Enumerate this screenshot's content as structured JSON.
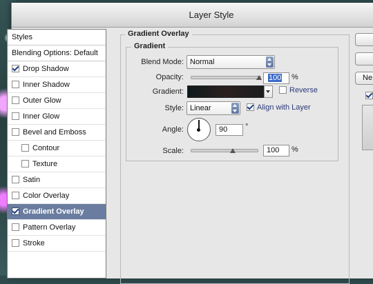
{
  "dialog": {
    "title": "Layer Style"
  },
  "styles_list": {
    "header": "Styles",
    "blending": "Blending Options: Default",
    "items": [
      {
        "label": "Drop Shadow",
        "checked": true,
        "selected": false,
        "indent": false
      },
      {
        "label": "Inner Shadow",
        "checked": false,
        "selected": false,
        "indent": false
      },
      {
        "label": "Outer Glow",
        "checked": false,
        "selected": false,
        "indent": false
      },
      {
        "label": "Inner Glow",
        "checked": false,
        "selected": false,
        "indent": false
      },
      {
        "label": "Bevel and Emboss",
        "checked": false,
        "selected": false,
        "indent": false
      },
      {
        "label": "Contour",
        "checked": false,
        "selected": false,
        "indent": true
      },
      {
        "label": "Texture",
        "checked": false,
        "selected": false,
        "indent": true
      },
      {
        "label": "Satin",
        "checked": false,
        "selected": false,
        "indent": false
      },
      {
        "label": "Color Overlay",
        "checked": false,
        "selected": false,
        "indent": false
      },
      {
        "label": "Gradient Overlay",
        "checked": true,
        "selected": true,
        "indent": false
      },
      {
        "label": "Pattern Overlay",
        "checked": false,
        "selected": false,
        "indent": false
      },
      {
        "label": "Stroke",
        "checked": false,
        "selected": false,
        "indent": false
      }
    ]
  },
  "panel": {
    "outer_title": "Gradient Overlay",
    "inner_title": "Gradient",
    "blend_mode_label": "Blend Mode:",
    "blend_mode_value": "Normal",
    "opacity_label": "Opacity:",
    "opacity_value": "100",
    "opacity_unit": "%",
    "opacity_fraction": 1.0,
    "gradient_label": "Gradient:",
    "reverse_label": "Reverse",
    "reverse_checked": false,
    "style_label": "Style:",
    "style_value": "Linear",
    "align_label": "Align with Layer",
    "align_checked": true,
    "angle_label": "Angle:",
    "angle_value": "90",
    "angle_unit": "°",
    "scale_label": "Scale:",
    "scale_value": "100",
    "scale_unit": "%"
  },
  "right_buttons": {
    "new_label_partial": "Ne"
  }
}
